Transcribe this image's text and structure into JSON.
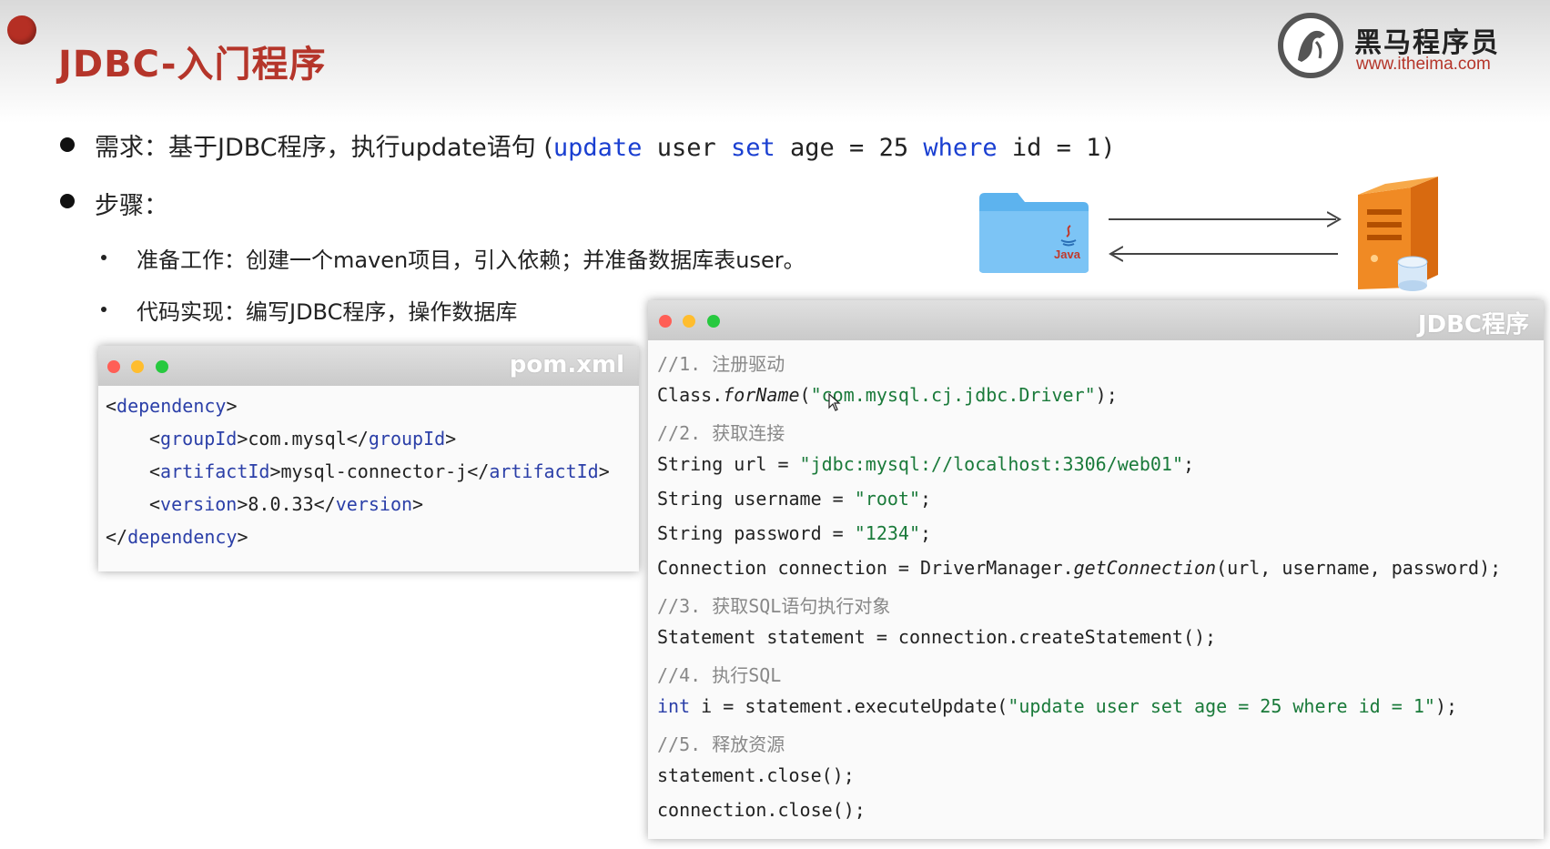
{
  "slide": {
    "title": "JDBC-入门程序",
    "logo": {
      "name_cn": "黑马程序员",
      "url": "www.itheima.com"
    }
  },
  "bullets": {
    "requirement": {
      "prefix": "需求：基于JDBC程序，执行update语句 (",
      "sql_update": "update",
      "sql_user": " user ",
      "sql_set": "set",
      "sql_age": " age = 25 ",
      "sql_where": "where",
      "sql_tail": " id = 1)"
    },
    "steps_label": "步骤：",
    "sub_items": [
      "准备工作：创建一个maven项目，引入依赖；并准备数据库表user。",
      "代码实现：编写JDBC程序，操作数据库"
    ]
  },
  "diagram": {
    "folder_label": "Java"
  },
  "pom_window": {
    "title": "pom.xml",
    "lines": [
      {
        "open": "<",
        "tag": "dependency",
        "mid": ">",
        "text": "",
        "open2": "",
        "tag2": "",
        "close": ""
      },
      {
        "open": "<",
        "tag": "groupId",
        "mid": ">",
        "text": "com.mysql",
        "open2": "</",
        "tag2": "groupId",
        "close": ">"
      },
      {
        "open": "<",
        "tag": "artifactId",
        "mid": ">",
        "text": "mysql-connector-j",
        "open2": "</",
        "tag2": "artifactId",
        "close": ">"
      },
      {
        "open": "<",
        "tag": "version",
        "mid": ">",
        "text": "8.0.33",
        "open2": "</",
        "tag2": "version",
        "close": ">"
      },
      {
        "open": "</",
        "tag": "dependency",
        "mid": ">",
        "text": "",
        "open2": "",
        "tag2": "",
        "close": ""
      }
    ]
  },
  "jdbc_window": {
    "title": "JDBC程序",
    "c1": "//1. 注册驱动",
    "l1a": "Class.",
    "l1b": "forName",
    "l1c": "(",
    "l1d": "\"com.mysql.cj.jdbc.Driver\"",
    "l1e": ");",
    "c2": "//2. 获取连接",
    "l2a": "String url = ",
    "l2b": "\"jdbc:mysql://localhost:3306/web01\"",
    "l2c": ";",
    "l3a": "String username = ",
    "l3b": "\"root\"",
    "l3c": ";",
    "l4a": "String password = ",
    "l4b": "\"1234\"",
    "l4c": ";",
    "l5a": "Connection connection = DriverManager.",
    "l5b": "getConnection",
    "l5c": "(url, username, password);",
    "c3": "//3. 获取SQL语句执行对象",
    "l6": "Statement statement = connection.createStatement();",
    "c4": "//4. 执行SQL",
    "l7a": "int",
    "l7b": " i = statement.executeUpdate(",
    "l7c": "\"update user set age = 25 where id = 1\"",
    "l7d": ");",
    "c5": "//5. 释放资源",
    "l8": "statement.close();",
    "l9": "connection.close();"
  },
  "colors": {
    "title_red": "#b5352a",
    "sql_keyword_blue": "#1a3fd1",
    "string_green": "#1a7a3a",
    "comment_gray": "#888888"
  }
}
